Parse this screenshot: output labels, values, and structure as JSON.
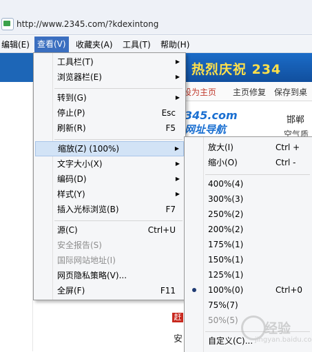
{
  "browser": {
    "url": "http://www.2345.com/?kdexintong"
  },
  "menubar": {
    "items": [
      {
        "label": "编辑(E)"
      },
      {
        "label": "查看(V)"
      },
      {
        "label": "收藏夹(A)"
      },
      {
        "label": "工具(T)"
      },
      {
        "label": "帮助(H)"
      }
    ]
  },
  "view_menu": {
    "items": [
      {
        "label": "工具栏(T)",
        "shortcut": "",
        "submenu": true
      },
      {
        "label": "浏览器栏(E)",
        "shortcut": "",
        "submenu": true
      },
      {
        "label": "转到(G)",
        "shortcut": "",
        "submenu": true
      },
      {
        "label": "停止(P)",
        "shortcut": "Esc"
      },
      {
        "label": "刷新(R)",
        "shortcut": "F5"
      },
      {
        "label": "缩放(Z) (100%)",
        "shortcut": "",
        "submenu": true
      },
      {
        "label": "文字大小(X)",
        "shortcut": "",
        "submenu": true
      },
      {
        "label": "编码(D)",
        "shortcut": "",
        "submenu": true
      },
      {
        "label": "样式(Y)",
        "shortcut": "",
        "submenu": true
      },
      {
        "label": "插入光标浏览(B)",
        "shortcut": "F7"
      },
      {
        "label": "源(C)",
        "shortcut": "Ctrl+U"
      },
      {
        "label": "安全报告(S)",
        "shortcut": ""
      },
      {
        "label": "国际网站地址(I)",
        "shortcut": ""
      },
      {
        "label": "网页隐私策略(V)...",
        "shortcut": ""
      },
      {
        "label": "全屏(F)",
        "shortcut": "F11"
      }
    ]
  },
  "zoom_menu": {
    "items": [
      {
        "label": "放大(I)",
        "shortcut": "Ctrl +"
      },
      {
        "label": "缩小(O)",
        "shortcut": "Ctrl -"
      },
      {
        "label": "400%(4)",
        "shortcut": ""
      },
      {
        "label": "300%(3)",
        "shortcut": ""
      },
      {
        "label": "250%(2)",
        "shortcut": ""
      },
      {
        "label": "200%(2)",
        "shortcut": ""
      },
      {
        "label": "175%(1)",
        "shortcut": ""
      },
      {
        "label": "150%(1)",
        "shortcut": ""
      },
      {
        "label": "125%(1)",
        "shortcut": ""
      },
      {
        "label": "100%(0)",
        "shortcut": "Ctrl+0",
        "checked": true
      },
      {
        "label": "75%(7)",
        "shortcut": ""
      },
      {
        "label": "50%(5)",
        "shortcut": ""
      },
      {
        "label": "自定义(C)...",
        "shortcut": ""
      }
    ]
  },
  "page": {
    "banner_text": "热烈庆祝 234",
    "set_home": "设为主页",
    "home_repair": "主页修复",
    "save_desktop": "保存到桌",
    "logo_line1": "345.com",
    "logo_line2": "网址导航",
    "city": "邯郸",
    "air": "空气质",
    "low_badge": "赶",
    "low_text": "安",
    "watermark": "经验",
    "watermark_url": "jingyan.baidu.com"
  }
}
